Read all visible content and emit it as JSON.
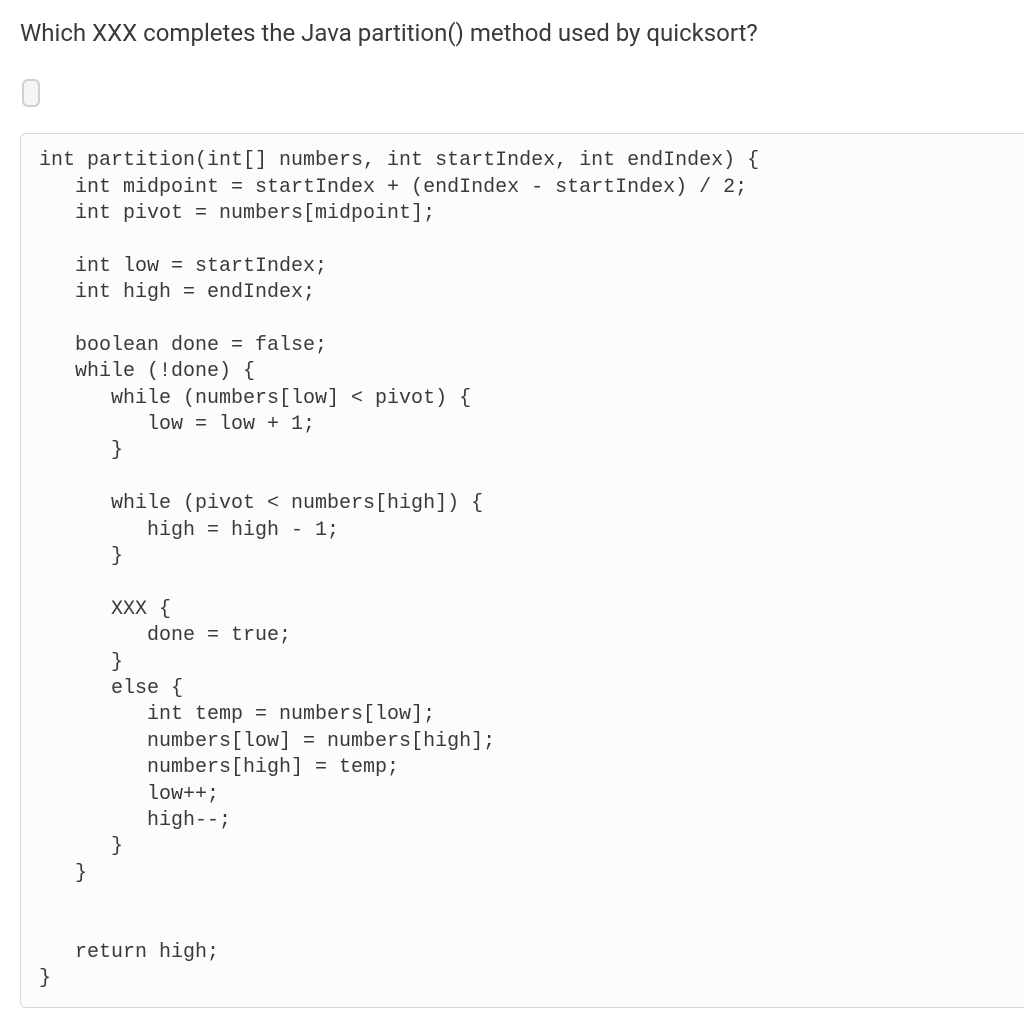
{
  "question": "Which XXX completes the Java partition() method used by quicksort?",
  "code": "int partition(int[] numbers, int startIndex, int endIndex) {\n   int midpoint = startIndex + (endIndex - startIndex) / 2;\n   int pivot = numbers[midpoint];\n\n   int low = startIndex;\n   int high = endIndex;\n\n   boolean done = false;\n   while (!done) {\n      while (numbers[low] < pivot) {\n         low = low + 1;\n      }\n\n      while (pivot < numbers[high]) {\n         high = high - 1;\n      }\n\n      XXX {\n         done = true;\n      }\n      else {\n         int temp = numbers[low];\n         numbers[low] = numbers[high];\n         numbers[high] = temp;\n         low++;\n         high--;\n      }\n   }\n\n\n   return high;\n}"
}
